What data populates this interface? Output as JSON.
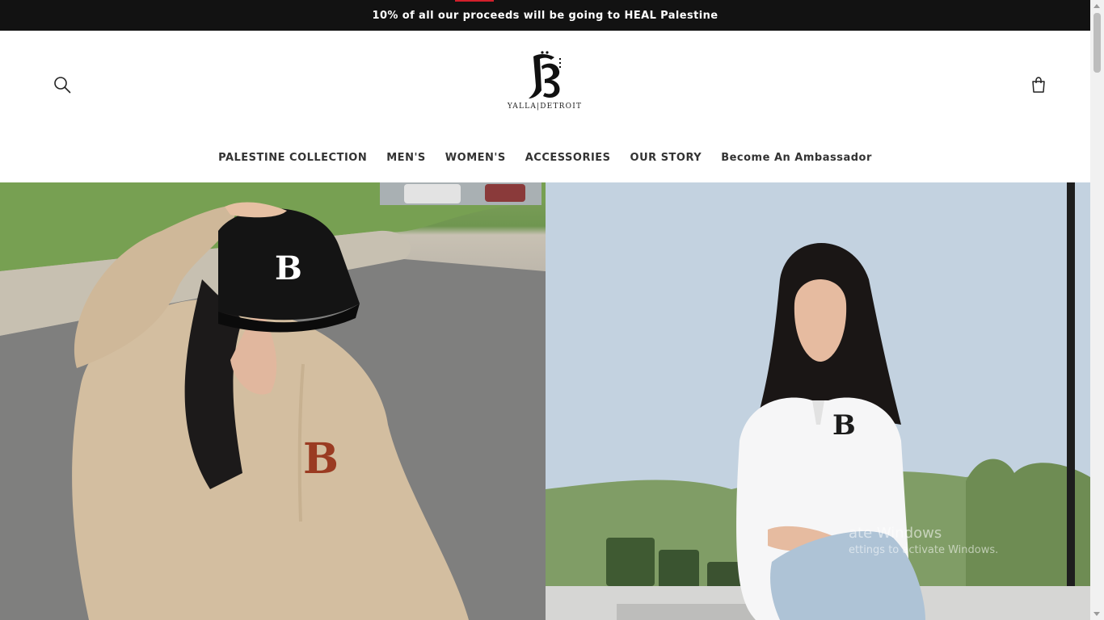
{
  "announcement": {
    "text": "10% of all our proceeds will be going to HEAL Palestine"
  },
  "header": {
    "logo_text": "YALLA|DETROIT",
    "search_icon": "search-icon",
    "cart_icon": "cart-icon"
  },
  "nav": {
    "items": [
      {
        "label": "PALESTINE COLLECTION"
      },
      {
        "label": "MEN'S"
      },
      {
        "label": "WOMEN'S"
      },
      {
        "label": "ACCESSORIES"
      },
      {
        "label": "OUR STORY"
      },
      {
        "label": "Become An Ambassador"
      }
    ]
  },
  "hero": {
    "left_image": "woman-in-beige-hoodie-and-black-cap",
    "right_image": "woman-in-white-zip-hoodie-sitting"
  },
  "watermark": {
    "title": "ate Windows",
    "subtitle": "ettings to activate Windows."
  },
  "colors": {
    "announcement_bg": "#121212",
    "announcement_text": "#ffffff",
    "nav_text": "#333333",
    "accent_red": "#d21f2b"
  }
}
